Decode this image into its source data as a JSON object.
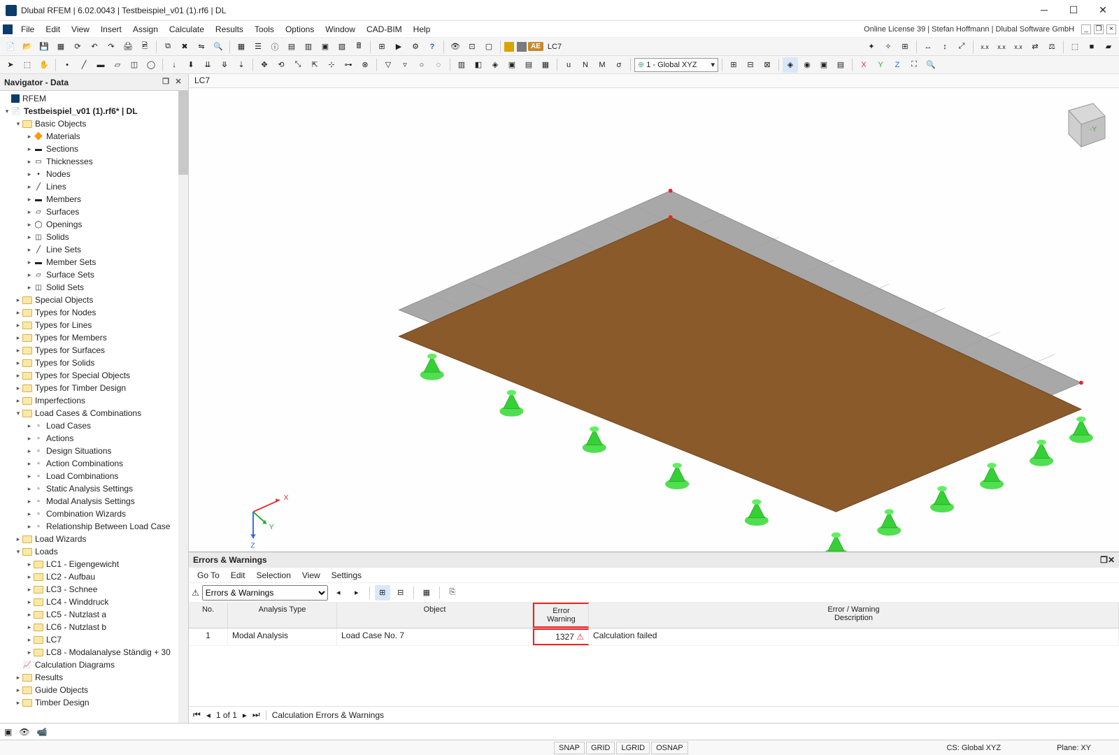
{
  "window": {
    "title": "Dlubal RFEM | 6.02.0043 | Testbeispiel_v01 (1).rf6 | DL",
    "license": "Online License 39 | Stefan Hoffmann | Dlubal Software GmbH"
  },
  "menus": [
    "File",
    "Edit",
    "View",
    "Insert",
    "Assign",
    "Calculate",
    "Results",
    "Tools",
    "Options",
    "Window",
    "CAD-BIM",
    "Help"
  ],
  "toolbar1": {
    "ae_badge": "AE",
    "loadcase": "LC7",
    "coord_sys": "1 - Global XYZ"
  },
  "navigator": {
    "title": "Navigator - Data",
    "root": "RFEM",
    "project": "Testbeispiel_v01 (1).rf6* | DL",
    "basic_objects": {
      "label": "Basic Objects",
      "children": [
        "Materials",
        "Sections",
        "Thicknesses",
        "Nodes",
        "Lines",
        "Members",
        "Surfaces",
        "Openings",
        "Solids",
        "Line Sets",
        "Member Sets",
        "Surface Sets",
        "Solid Sets"
      ]
    },
    "folders1": [
      "Special Objects",
      "Types for Nodes",
      "Types for Lines",
      "Types for Members",
      "Types for Surfaces",
      "Types for Solids",
      "Types for Special Objects",
      "Types for Timber Design",
      "Imperfections"
    ],
    "load_cases_comb": {
      "label": "Load Cases & Combinations",
      "children": [
        "Load Cases",
        "Actions",
        "Design Situations",
        "Action Combinations",
        "Load Combinations",
        "Static Analysis Settings",
        "Modal Analysis Settings",
        "Combination Wizards",
        "Relationship Between Load Case"
      ]
    },
    "load_wizards": "Load Wizards",
    "loads": {
      "label": "Loads",
      "children": [
        "LC1 - Eigengewicht",
        "LC2 - Aufbau",
        "LC3 - Schnee",
        "LC4 - Winddruck",
        "LC5 - Nutzlast a",
        "LC6 - Nutzlast b",
        "LC7",
        "LC8 - Modalanalyse Ständig + 30"
      ]
    },
    "after_loads": [
      "Calculation Diagrams",
      "Results",
      "Guide Objects",
      "Timber Design"
    ]
  },
  "viewport": {
    "tab": "LC7",
    "axes": {
      "x": "X",
      "y": "Y",
      "z": "Z"
    },
    "cube_face": "-Y"
  },
  "errors": {
    "title_bar": "Errors & Warnings",
    "menus": [
      "Go To",
      "Edit",
      "Selection",
      "View",
      "Settings"
    ],
    "dropdown": "Errors & Warnings",
    "columns": {
      "no": "No.",
      "analysis": "Analysis Type",
      "object": "Object",
      "ew1": "Error",
      "ew2": "Warning",
      "desc1": "Error / Warning",
      "desc2": "Description"
    },
    "rows": [
      {
        "no": "1",
        "type": "Modal Analysis",
        "object": "Load Case No. 7",
        "ew": "1327",
        "desc": "Calculation failed"
      }
    ],
    "pager": {
      "pos": "1 of 1",
      "tab": "Calculation Errors & Warnings"
    }
  },
  "statusbar": {
    "toggles": [
      "SNAP",
      "GRID",
      "LGRID",
      "OSNAP"
    ],
    "cs": "CS: Global XYZ",
    "plane": "Plane: XY"
  }
}
